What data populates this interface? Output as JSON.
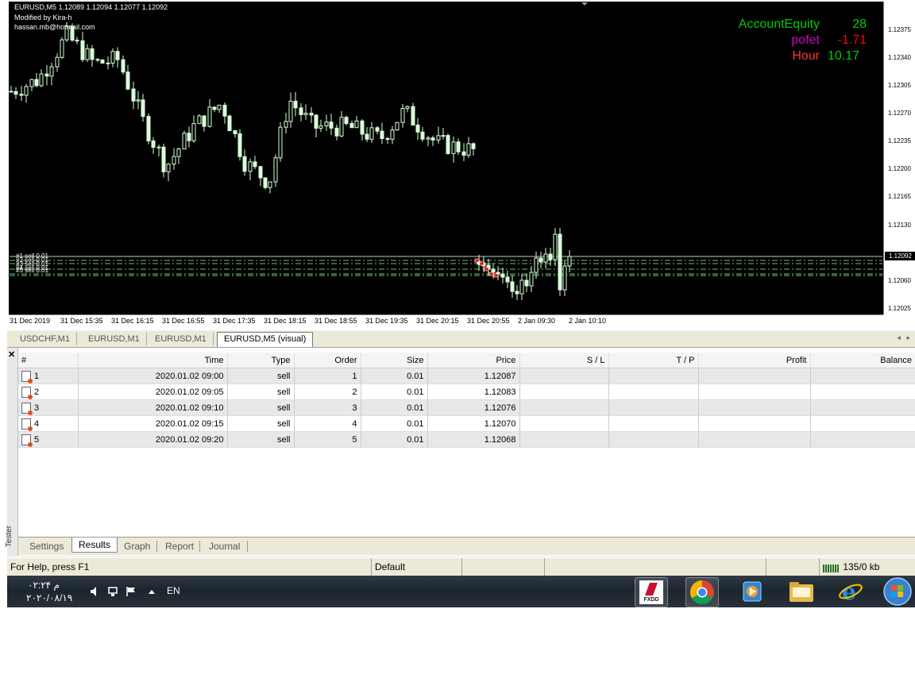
{
  "chart": {
    "info": [
      "EURUSD,M5  1.12089 1.12094 1.12077 1.12092",
      "Modified by Kira-h",
      "hassan.mb@hotmail.com"
    ],
    "indicators": [
      {
        "label": "AccountEquity",
        "value": "28",
        "label_color": "#00cc00",
        "value_color": "#00cc00"
      },
      {
        "label": "pofet",
        "value": "-1.71",
        "label_color": "#cc00cc",
        "value_color": "#ff0000"
      },
      {
        "label": "Hour",
        "value": "10.17",
        "label_color": "#ff3333",
        "value_color": "#00cc00"
      }
    ],
    "price_axis": [
      "1.12375",
      "1.12340",
      "1.12305",
      "1.12270",
      "1.12235",
      "1.12200",
      "1.12165",
      "1.12130",
      "1.12092",
      "1.12060",
      "1.12025"
    ],
    "current_price": "1.12092",
    "time_axis": [
      "31 Dec 2019",
      "31 Dec 15:35",
      "31 Dec 16:15",
      "31 Dec 16:55",
      "31 Dec 17:35",
      "31 Dec 18:15",
      "31 Dec 18:55",
      "31 Dec 19:35",
      "31 Dec 20:15",
      "31 Dec 20:55",
      "2 Jan 09:30",
      "2 Jan 10:10"
    ],
    "order_lines": [
      "#1 sell 0.01",
      "#2 sell 0.01",
      "#3 sell 0.01",
      "#4 sell 0.01",
      "#5 sell 0.01"
    ],
    "colors": {
      "background": "#000000",
      "candle": "#d8ffd8",
      "grid_line": "#6fbf6f",
      "order_marker": "#ff0000"
    }
  },
  "chart_tabs": [
    {
      "label": "USDCHF,M1",
      "active": false
    },
    {
      "label": "EURUSD,M1",
      "active": false
    },
    {
      "label": "EURUSD,M1",
      "active": false
    },
    {
      "label": "EURUSD,M5 (visual)",
      "active": true
    }
  ],
  "terminal": {
    "close_icon": "✕",
    "side_label": "Tester",
    "columns": [
      "#",
      "Time",
      "Type",
      "Order",
      "Size",
      "Price",
      "S / L",
      "T / P",
      "Profit",
      "Balance"
    ],
    "rows": [
      {
        "id": "1",
        "time": "2020.01.02 09:00",
        "type": "sell",
        "order": "1",
        "size": "0.01",
        "price": "1.12087",
        "sl": "",
        "tp": "",
        "profit": "",
        "balance": ""
      },
      {
        "id": "2",
        "time": "2020.01.02 09:05",
        "type": "sell",
        "order": "2",
        "size": "0.01",
        "price": "1.12083",
        "sl": "",
        "tp": "",
        "profit": "",
        "balance": ""
      },
      {
        "id": "3",
        "time": "2020.01.02 09:10",
        "type": "sell",
        "order": "3",
        "size": "0.01",
        "price": "1.12076",
        "sl": "",
        "tp": "",
        "profit": "",
        "balance": ""
      },
      {
        "id": "4",
        "time": "2020.01.02 09:15",
        "type": "sell",
        "order": "4",
        "size": "0.01",
        "price": "1.12070",
        "sl": "",
        "tp": "",
        "profit": "",
        "balance": ""
      },
      {
        "id": "5",
        "time": "2020.01.02 09:20",
        "type": "sell",
        "order": "5",
        "size": "0.01",
        "price": "1.12068",
        "sl": "",
        "tp": "",
        "profit": "",
        "balance": ""
      }
    ],
    "tabs": [
      {
        "label": "Settings",
        "active": false
      },
      {
        "label": "Results",
        "active": true
      },
      {
        "label": "Graph",
        "active": false
      },
      {
        "label": "Report",
        "active": false
      },
      {
        "label": "Journal",
        "active": false
      }
    ]
  },
  "status": {
    "help": "For Help, press F1",
    "profile": "Default",
    "traffic": "135/0 kb"
  },
  "taskbar": {
    "time": "۰۲:۲۴ م",
    "date": "۲۰۲۰/۰۸/۱۹",
    "language": "EN",
    "apps": [
      "fxdd-icon",
      "chrome-icon",
      "media-player-icon",
      "explorer-folder-icon",
      "internet-explorer-icon",
      "windows-start-icon"
    ],
    "fxdd_label": "FXDD"
  }
}
